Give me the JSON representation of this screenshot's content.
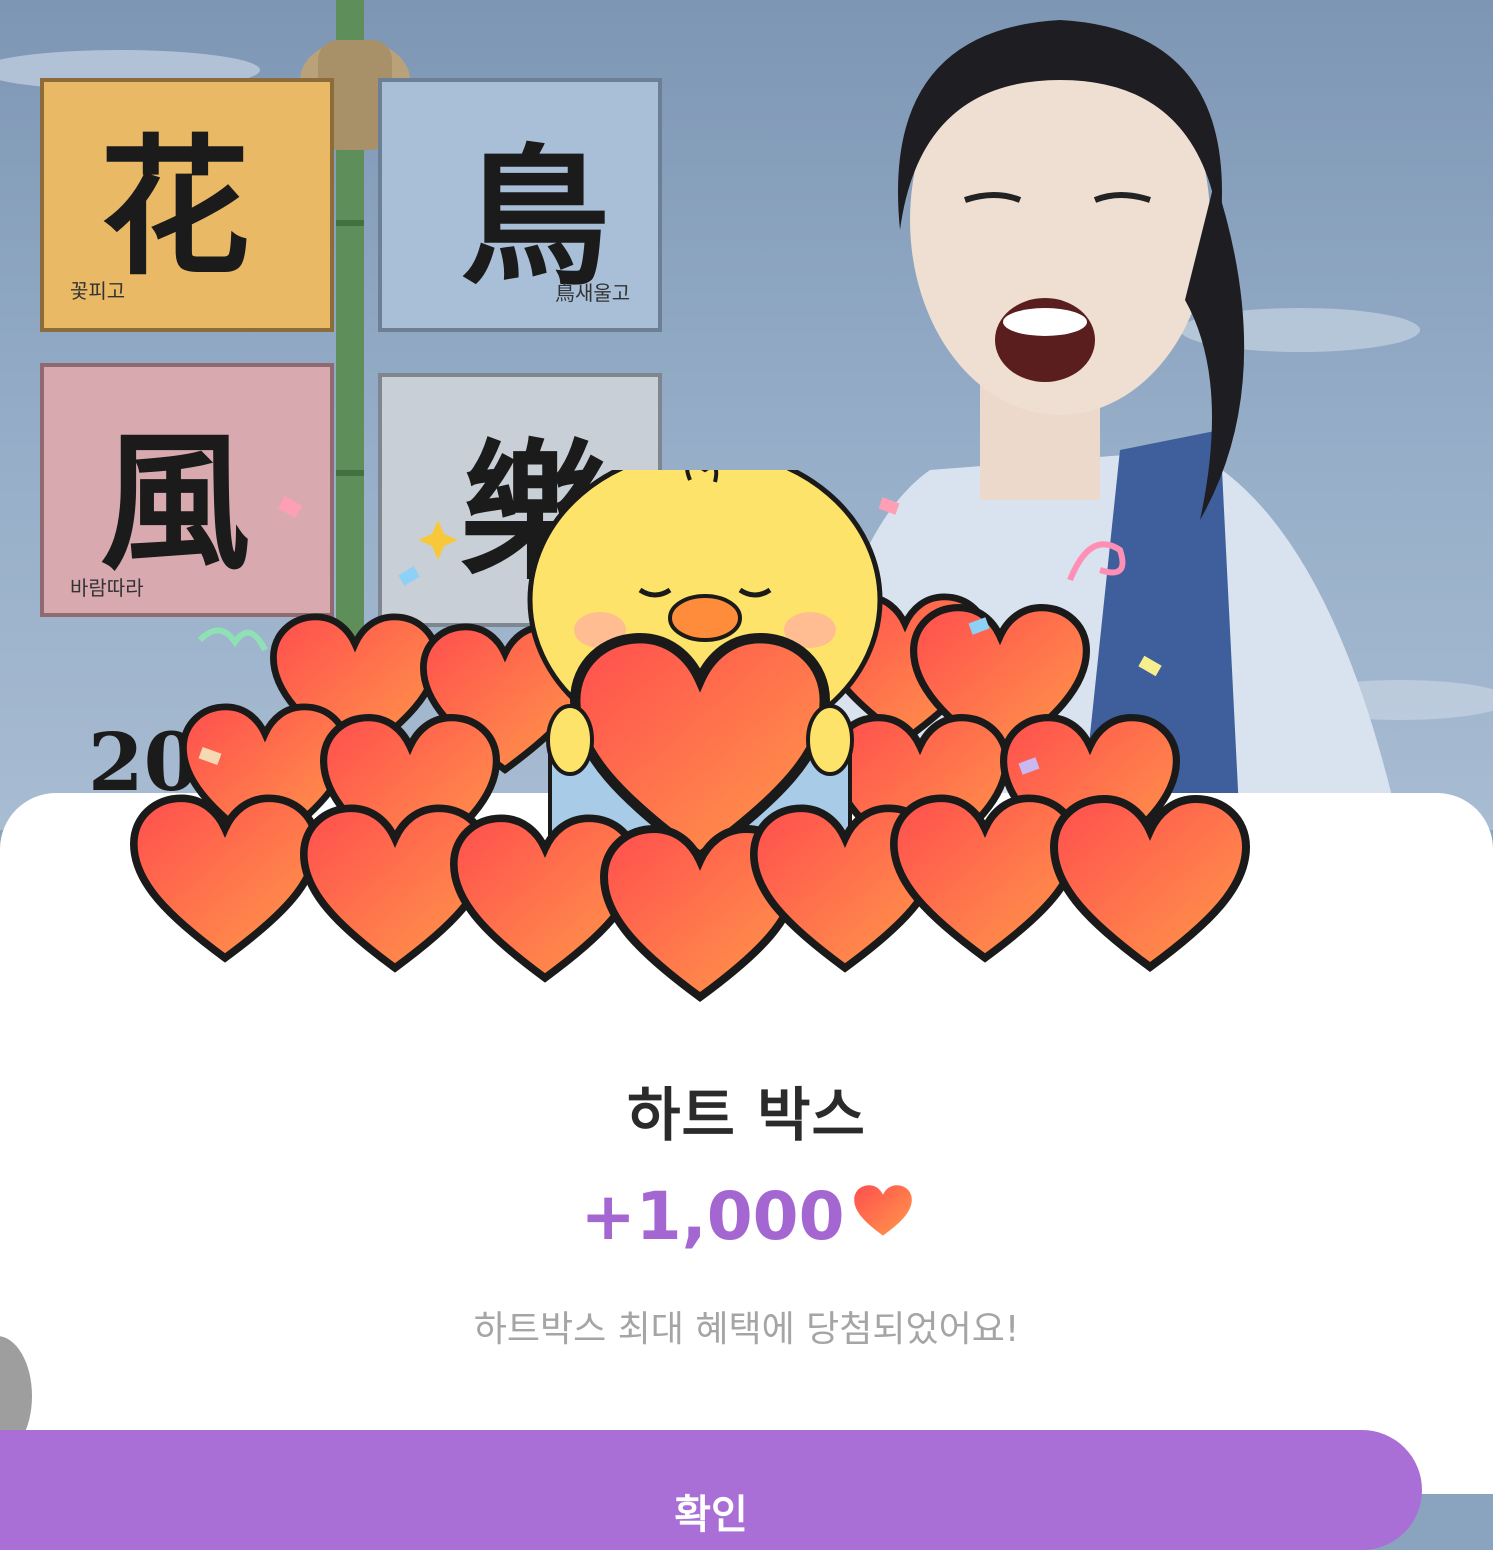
{
  "background": {
    "banners": [
      {
        "char": "花",
        "sub": "꽃피고",
        "color": "#e9b966"
      },
      {
        "char": "鳥",
        "sub": "鳥새울고",
        "color": "#a9bfd8"
      },
      {
        "char": "風",
        "sub": "바람따라",
        "color": "#d8aab0"
      },
      {
        "char": "樂",
        "sub": "",
        "color": "#c9cfd6"
      }
    ],
    "partial_year": "20"
  },
  "popup": {
    "title": "하트 박스",
    "amount": "+1,000",
    "message": "하트박스 최대 혜택에 당첨되었어요!",
    "confirm_label": "확인"
  },
  "colors": {
    "accent": "#a96fd6",
    "amount": "#a466d0",
    "heart": "#f25a3c"
  },
  "icons": {
    "heart": "heart-icon",
    "mascot": "chick-mascot-icon"
  }
}
